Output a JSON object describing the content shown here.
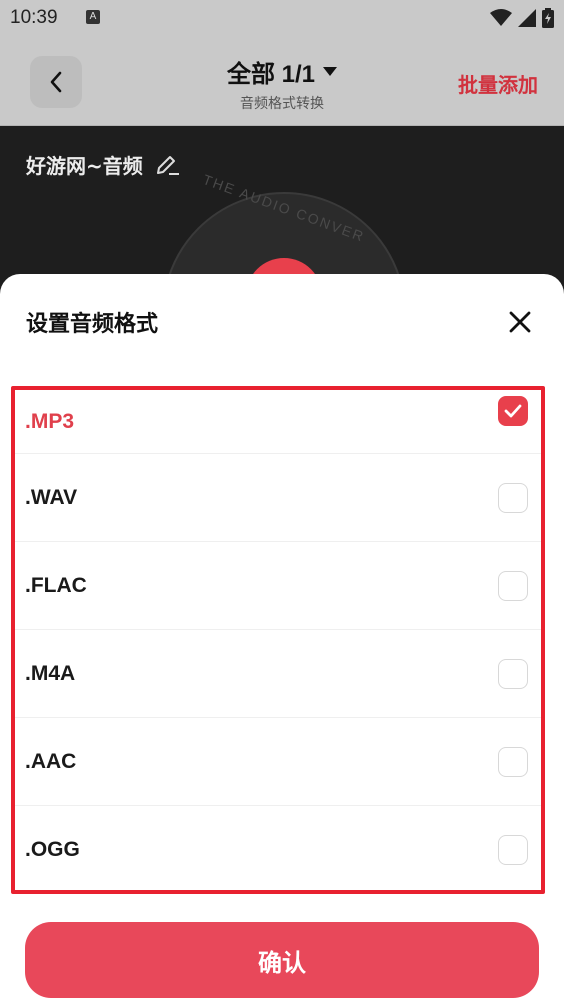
{
  "status_bar": {
    "time": "10:39",
    "notification_glyph": "A"
  },
  "header": {
    "title": "全部 1/1",
    "subtitle": "音频格式转换",
    "batch_add_label": "批量添加"
  },
  "background": {
    "audio_name": "好游网~音频",
    "vinyl_text": "THE AUDIO CONVER"
  },
  "sheet": {
    "title": "设置音频格式",
    "formats": [
      {
        "label": ".MP3",
        "checked": true
      },
      {
        "label": ".WAV",
        "checked": false
      },
      {
        "label": ".FLAC",
        "checked": false
      },
      {
        "label": ".M4A",
        "checked": false
      },
      {
        "label": ".AAC",
        "checked": false
      },
      {
        "label": ".OGG",
        "checked": false
      }
    ],
    "confirm_label": "确认"
  },
  "colors": {
    "accent": "#e8404c",
    "highlight_border": "#e8212f",
    "header_bg": "#c9c9c9"
  }
}
